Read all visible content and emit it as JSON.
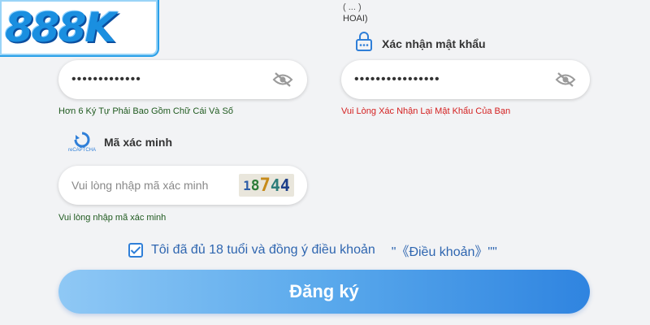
{
  "logo": {
    "text": "888K"
  },
  "top_hint": {
    "line1": "( ... )",
    "line2": "HOAI)"
  },
  "confirm_password": {
    "label": "Xác nhận mật khẩu",
    "value": "••••••••••••••••",
    "hint": "Vui Lòng Xác Nhận Lại Mật Khẩu Của Bạn"
  },
  "password": {
    "value": "•••••••••••••",
    "hint": "Hơn 6 Ký Tự Phải Bao Gồm Chữ Cái Và Số"
  },
  "captcha": {
    "badge": "reCAPTCHA",
    "label": "Mã xác minh",
    "placeholder": "Vui lòng nhập mã xác minh",
    "code_digits": [
      "1",
      "8",
      "7",
      "4",
      "4"
    ],
    "hint": "Vui lòng nhập mã xác minh"
  },
  "agreement": {
    "checked": true,
    "text": "Tôi đã đủ 18 tuổi và đồng ý điều khoản",
    "link": "\"《Điều khoản》\"\""
  },
  "submit": {
    "label": "Đăng ký"
  },
  "colors": {
    "accent": "#2f84e0",
    "error": "#d42020",
    "hint_green": "#1f5a1f"
  }
}
